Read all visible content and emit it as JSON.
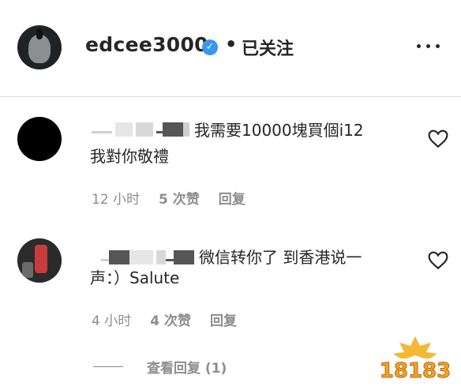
{
  "header": {
    "username": "edcee3000",
    "follow_status": "已关注",
    "separator": "•"
  },
  "comments": [
    {
      "text_line1": "我需要10000塊買個i12",
      "text_line2": "我對你敬禮",
      "time": "12 小时",
      "likes": "5 次赞",
      "reply": "回复"
    },
    {
      "text_line1": "微信转你了 到香港说一",
      "text_line2": "声：）Salute",
      "time": "4 小时",
      "likes": "4 次赞",
      "reply": "回复"
    }
  ],
  "view_replies": "查看回复 (1)",
  "watermark": "18183",
  "colors": {
    "text": "#262626",
    "secondary": "#8e8e8e",
    "verified": "#3897f0",
    "divider": "#dbdbdb"
  }
}
